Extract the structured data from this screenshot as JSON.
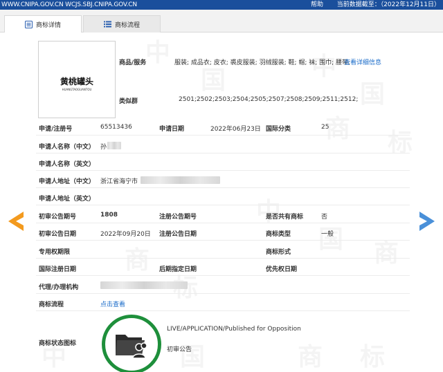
{
  "topbar": {
    "site": "WWW.CNIPA.GOV.CN WCJS.SBJ.CNIPA.GOV.CN",
    "help": "帮助",
    "data_as_of": "当前数据截至：（2022年12月11日）"
  },
  "tabs": [
    {
      "label": "商标详情",
      "active": true,
      "icon": "document-list-icon"
    },
    {
      "label": "商标流程",
      "active": false,
      "icon": "list-icon"
    }
  ],
  "logo": {
    "chars": "黄桃罐头",
    "pinyin": "HUANGTAOGUANTOU"
  },
  "goods": {
    "label": "商品/服务",
    "value": "服装; 成品衣; 皮衣; 裘皮服装; 羽绒服装; 鞋; 帽; 袜; 围巾; 腰带;",
    "more_link": "查看详细信息"
  },
  "similar_group": {
    "label": "类似群",
    "value": "2501;2502;2503;2504;2505;2507;2508;2509;2511;2512;"
  },
  "fields": {
    "reg_no_label": "申请/注册号",
    "reg_no": "65513436",
    "app_date_label": "申请日期",
    "app_date": "2022年06月23日",
    "intl_class_label": "国际分类",
    "intl_class": "25",
    "applicant_cn_label": "申请人名称（中文）",
    "applicant_cn": "孙",
    "applicant_en_label": "申请人名称（英文）",
    "addr_cn_label": "申请人地址（中文）",
    "addr_cn": "浙江省海宁市",
    "addr_en_label": "申请人地址（英文）",
    "prelim_issue_label": "初审公告期号",
    "prelim_issue": "1808",
    "reg_issue_label": "注册公告期号",
    "shared_label": "是否共有商标",
    "shared": "否",
    "prelim_date_label": "初审公告日期",
    "prelim_date": "2022年09月20日",
    "reg_date_label": "注册公告日期",
    "tm_type_label": "商标类型",
    "tm_type": "一般",
    "exclusive_label": "专用权期限",
    "tm_form_label": "商标形式",
    "intl_reg_date_label": "国际注册日期",
    "later_date_label": "后期指定日期",
    "priority_date_label": "优先权日期",
    "agent_label": "代理/办理机构",
    "process_label": "商标流程",
    "process_link": "点击查看",
    "status_icon_label": "商标状态图标",
    "status_en": "LIVE/APPLICATION/Published for Opposition",
    "status_cn": "初审公告"
  },
  "colors": {
    "topbar": "#1a4f9c",
    "link": "#1a6bc9",
    "prev_arrow": "#f39a1e",
    "next_arrow": "#4a90d9",
    "status_ring": "#1e8f3b"
  },
  "watermark": "中国商标"
}
